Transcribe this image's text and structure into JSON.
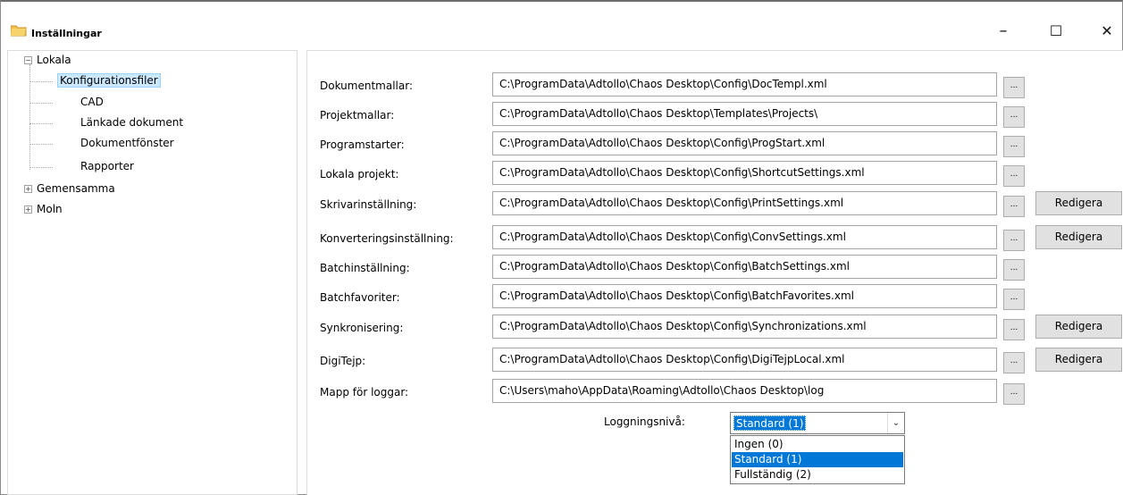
{
  "window": {
    "title": "Inställningar",
    "controls": {
      "minimize": "–",
      "maximize": "☐",
      "close": "✕"
    }
  },
  "tree": {
    "root_local": "Lokala",
    "local_children": [
      "Konfigurationsfiler",
      "CAD",
      "Länkade dokument",
      "Dokumentfönster",
      "Rapporter"
    ],
    "selected": "Konfigurationsfiler",
    "root_shared": "Gemensamma",
    "root_cloud": "Moln",
    "expanded_glyph": "⊟",
    "collapsed_glyph": "⊞"
  },
  "settings": {
    "browse_label": "...",
    "edit_label": "Redigera",
    "rows": [
      {
        "label": "Dokumentmallar:",
        "path": "C:\\ProgramData\\Adtollo\\Chaos Desktop\\Config\\DocTempl.xml",
        "has_edit": false
      },
      {
        "label": "Projektmallar:",
        "path": "C:\\ProgramData\\Adtollo\\Chaos Desktop\\Templates\\Projects\\",
        "has_edit": false
      },
      {
        "label": "Programstarter:",
        "path": "C:\\ProgramData\\Adtollo\\Chaos Desktop\\Config\\ProgStart.xml",
        "has_edit": false
      },
      {
        "label": "Lokala projekt:",
        "path": "C:\\ProgramData\\Adtollo\\Chaos Desktop\\Config\\ShortcutSettings.xml",
        "has_edit": false
      },
      {
        "label": "Skrivarinställning:",
        "path": "C:\\ProgramData\\Adtollo\\Chaos Desktop\\Config\\PrintSettings.xml",
        "has_edit": true
      },
      {
        "label": "Konverteringsinställning:",
        "path": "C:\\ProgramData\\Adtollo\\Chaos Desktop\\Config\\ConvSettings.xml",
        "has_edit": true
      },
      {
        "label": "Batchinställning:",
        "path": "C:\\ProgramData\\Adtollo\\Chaos Desktop\\Config\\BatchSettings.xml",
        "has_edit": false
      },
      {
        "label": "Batchfavoriter:",
        "path": "C:\\ProgramData\\Adtollo\\Chaos Desktop\\Config\\BatchFavorites.xml",
        "has_edit": false
      },
      {
        "label": "Synkronisering:",
        "path": "C:\\ProgramData\\Adtollo\\Chaos Desktop\\Config\\Synchronizations.xml",
        "has_edit": true
      },
      {
        "label": "DigiTejp:",
        "path": "C:\\ProgramData\\Adtollo\\Chaos Desktop\\Config\\DigiTejpLocal.xml",
        "has_edit": true
      },
      {
        "label": "Mapp för loggar:",
        "path": "C:\\Users\\maho\\AppData\\Roaming\\Adtollo\\Chaos Desktop\\log",
        "has_edit": false
      }
    ]
  },
  "logging": {
    "label": "Loggningsnivå:",
    "selected_value": "Standard (1)",
    "options": [
      "Ingen (0)",
      "Standard (1)",
      "Fullständig (2)"
    ],
    "selected_index": 1
  },
  "colors": {
    "selection_blue": "#0078d7",
    "tree_selection": "#cce8ff",
    "button_face": "#e1e1e1",
    "folder_icon": "#f2c14e"
  }
}
